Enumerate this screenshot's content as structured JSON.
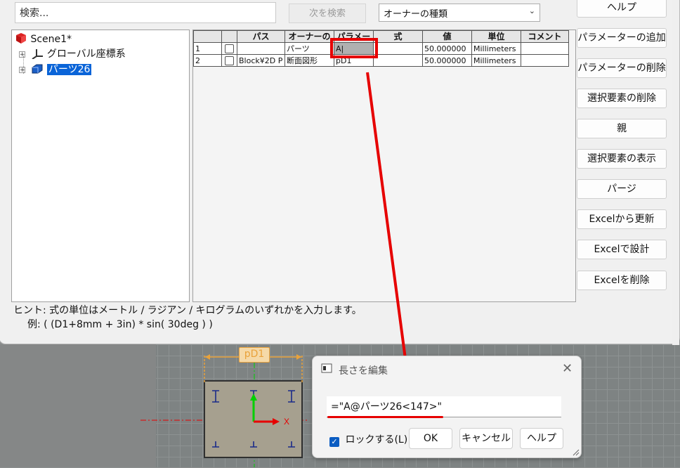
{
  "search": {
    "placeholder": "検索..."
  },
  "next_search_label": "次を検索",
  "owner_type_select": "オーナーの種類",
  "tree": {
    "items": [
      {
        "label": "Scene1*"
      },
      {
        "label": "グローバル座標系"
      },
      {
        "label": "パーツ26",
        "selected": true
      }
    ]
  },
  "grid": {
    "columns": [
      "",
      "",
      "パス",
      "オーナーの",
      "パラメー",
      "式",
      "値",
      "単位",
      "コメント"
    ],
    "rows": [
      {
        "no": "1",
        "path": "",
        "owner": "パーツ",
        "param": "A|",
        "expr": "",
        "value": "50.000000",
        "unit": "Millimeters",
        "comment": ""
      },
      {
        "no": "2",
        "path": "Block¥2D P",
        "owner": "断面図形",
        "param": "pD1",
        "expr": "",
        "value": "50.000000",
        "unit": "Millimeters",
        "comment": ""
      }
    ]
  },
  "right_buttons": [
    "ヘルプ",
    "パラメーターの追加",
    "パラメーターの削除",
    "選択要素の削除",
    "親",
    "選択要素の表示",
    "パージ",
    "Excelから更新",
    "Excelで設計",
    "Excelを削除"
  ],
  "hint": {
    "line1": "ヒント: 式の単位はメートル / ラジアン / キログラムのいずれかを入力します。",
    "line2": "例: ( (D1+8mm + 3in) * sin( 30deg ) )"
  },
  "sketch": {
    "dim_label": "pD1"
  },
  "edit_dialog": {
    "title": "長さを編集",
    "value": "=\"A@パーツ26<147>\"",
    "lock_label": "ロックする(L)",
    "lock_checked": true,
    "ok_label": "OK",
    "cancel_label": "キャンセル",
    "help_label": "ヘルプ"
  },
  "colors": {
    "accent": "#0a64d8",
    "highlight": "#e60000",
    "dim": "#e9a23b"
  }
}
